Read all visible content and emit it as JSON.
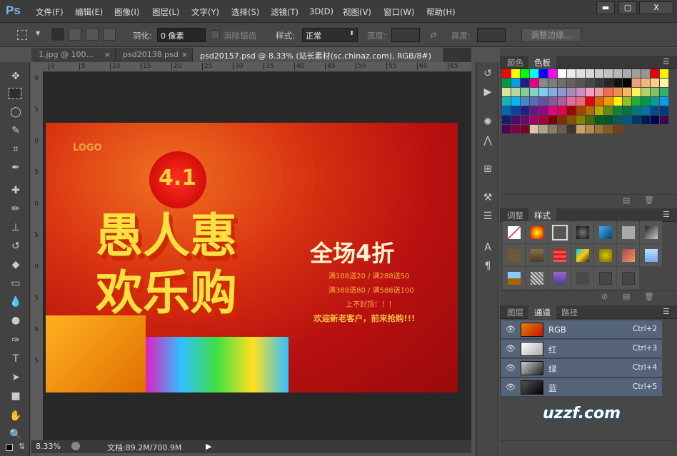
{
  "app": {
    "logo": "Ps",
    "menu": [
      "文件(F)",
      "编辑(E)",
      "图像(I)",
      "图层(L)",
      "文字(Y)",
      "选择(S)",
      "滤镜(T)",
      "3D(D)",
      "视图(V)",
      "窗口(W)",
      "帮助(H)"
    ],
    "window_buttons": [
      "▬",
      "▢",
      "X"
    ]
  },
  "options": {
    "feather_label": "羽化:",
    "feather_value": "0 像素",
    "antialias_label": "消除锯齿",
    "style_label": "样式:",
    "style_value": "正常",
    "width_label": "宽度:",
    "height_label": "高度:",
    "refine_edge": "调整边缘..."
  },
  "tabs": [
    {
      "label": "1.jpg @ 100...",
      "close": "×"
    },
    {
      "label": "psd20138.psd",
      "close": "×"
    },
    {
      "label": "psd20157.psd @ 8.33% (站长素材(sc.chinaz.com), RGB/8#) *",
      "close": "×"
    }
  ],
  "ruler": {
    "h": [
      "0",
      "5",
      "10",
      "15",
      "20",
      "25",
      "30",
      "35",
      "40",
      "45",
      "50",
      "55",
      "60",
      "65"
    ],
    "v": [
      "0",
      "5",
      "0",
      "5",
      "0",
      "5",
      "0",
      "5",
      "0",
      "5"
    ]
  },
  "artwork": {
    "logo": "LOGO",
    "date": "4.1",
    "title1": "愚人惠",
    "title2": "欢乐购",
    "discount": "全场4折",
    "line1": "满188送20 / 满288送50",
    "line2": "满388送80 / 满588送100",
    "line3": "上不封顶！！！",
    "line4": "欢迎新老客户，前来抢购!!!"
  },
  "status": {
    "zoom": "8.33%",
    "doc": "文档:89.2M/700.9M"
  },
  "color_panel": {
    "tabs": [
      "颜色",
      "色板"
    ],
    "active": "色板",
    "swatches": [
      "#ff0000",
      "#ffff00",
      "#00ff00",
      "#00ffff",
      "#0000ff",
      "#ff00ff",
      "#ffffff",
      "#ebebeb",
      "#e1e1e1",
      "#d7d7d7",
      "#cccccc",
      "#c2c2c2",
      "#b7b7b7",
      "#acacac",
      "#a0a0a0",
      "#959595",
      "#e60012",
      "#fff100",
      "#009944",
      "#00a0e9",
      "#1d2088",
      "#e4007f",
      "#898989",
      "#7d7d7d",
      "#707070",
      "#626262",
      "#555555",
      "#464646",
      "#363636",
      "#262626",
      "#111111",
      "#000000",
      "#f19f7b",
      "#f8b47c",
      "#facd89",
      "#fff799",
      "#d7e6a0",
      "#b3d89c",
      "#89c997",
      "#88cfc9",
      "#7ecef4",
      "#88abda",
      "#8c97cb",
      "#aa89bd",
      "#c490bf",
      "#f19ec2",
      "#f29c9f",
      "#f26e4e",
      "#f19149",
      "#fdb463",
      "#fff45c",
      "#b3d465",
      "#80c269",
      "#32b16c",
      "#13b5b1",
      "#00b7ee",
      "#448aca",
      "#556fb5",
      "#5f52a0",
      "#8957a1",
      "#ae5da1",
      "#ea68a2",
      "#eb6877",
      "#e60012",
      "#eb6100",
      "#f39800",
      "#fff100",
      "#8fc31f",
      "#22ac38",
      "#009944",
      "#009e96",
      "#00a0e9",
      "#0068b7",
      "#00479d",
      "#1d2088",
      "#601986",
      "#920783",
      "#e4007f",
      "#e5004f",
      "#a40000",
      "#a84200",
      "#b46c00",
      "#b7aa00",
      "#5f8a1c",
      "#0f8534",
      "#00743b",
      "#007a73",
      "#0075a9",
      "#004c8c",
      "#003a80",
      "#0f1e6d",
      "#4c0d68",
      "#6a0c67",
      "#a50064",
      "#a5003a",
      "#7d0000",
      "#7f2f00",
      "#8a5100",
      "#897e00",
      "#486a0f",
      "#005e1e",
      "#00572a",
      "#005e58",
      "#005983",
      "#00386c",
      "#001c58",
      "#040055",
      "#3b0350",
      "#510055",
      "#7e004b",
      "#7d002a",
      "#d8c6a4",
      "#b5a186",
      "#8c7b63",
      "#6e5d4a",
      "#3e3432",
      "#c8a46a",
      "#b88a4c",
      "#9e7333",
      "#875a25",
      "#734016"
    ]
  },
  "styles_panel": {
    "tabs": [
      "调整",
      "样式"
    ],
    "active": "样式"
  },
  "channels_panel": {
    "tabs": [
      "图层",
      "通道",
      "路径"
    ],
    "active": "通道",
    "channels": [
      {
        "name": "RGB",
        "shortcut": "Ctrl+2"
      },
      {
        "name": "红",
        "shortcut": "Ctrl+3"
      },
      {
        "name": "绿",
        "shortcut": "Ctrl+4"
      },
      {
        "name": "蓝",
        "shortcut": "Ctrl+5"
      }
    ]
  },
  "watermark": "uzzf.com"
}
